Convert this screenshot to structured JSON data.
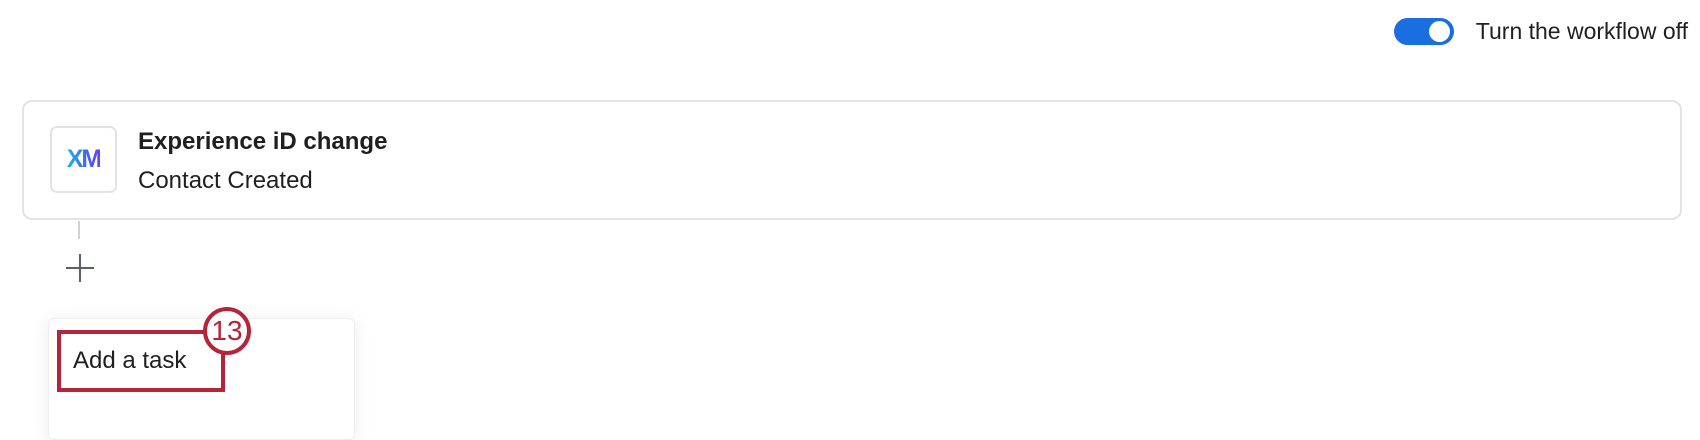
{
  "header": {
    "toggle_label": "Turn the workflow off",
    "toggle_state": "on",
    "toggle_color": "#1a6ee0"
  },
  "workflow_card": {
    "logo_text": "XM",
    "title": "Experience iD change",
    "subtitle": "Contact Created"
  },
  "add_button": {
    "icon": "plus-icon"
  },
  "menu": {
    "items": [
      {
        "label": "Add a task"
      }
    ]
  },
  "annotation": {
    "step_number": "13",
    "color": "#b5253a"
  }
}
